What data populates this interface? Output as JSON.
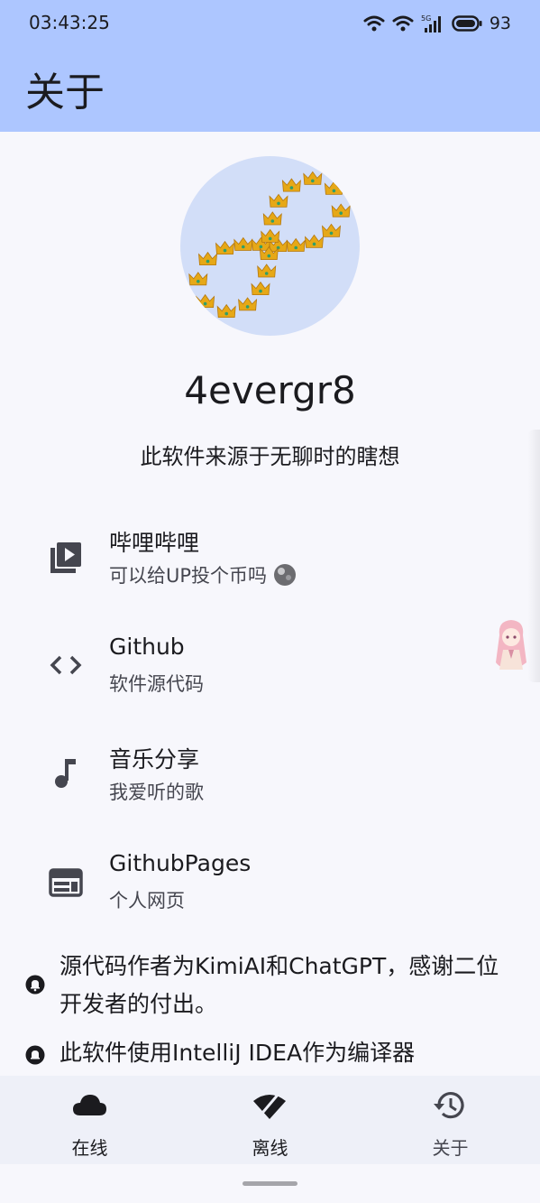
{
  "status_bar": {
    "time": "03:43:25",
    "battery": "93",
    "network": "5G"
  },
  "app_bar": {
    "title": "关于"
  },
  "profile": {
    "username": "4evergr8",
    "tagline": "此软件来源于无聊时的瞎想"
  },
  "links": [
    {
      "title": "哔哩哔哩",
      "subtitle": "可以给UP投个币吗",
      "icon": "video-library-icon"
    },
    {
      "title": "Github",
      "subtitle": "软件源代码",
      "icon": "code-icon"
    },
    {
      "title": "音乐分享",
      "subtitle": "我爱听的歌",
      "icon": "music-note-icon"
    },
    {
      "title": "GithubPages",
      "subtitle": "个人网页",
      "icon": "web-page-icon"
    }
  ],
  "notes": [
    {
      "text": "源代码作者为KimiAI和ChatGPT，感谢二位开发者的付出。"
    },
    {
      "text": "此软件使用IntelliJ IDEA作为编译器"
    }
  ],
  "bottom_nav": [
    {
      "label": "在线",
      "icon": "cloud-icon"
    },
    {
      "label": "离线",
      "icon": "wifi-off-icon"
    },
    {
      "label": "关于",
      "icon": "history-icon"
    }
  ],
  "colors": {
    "top_bar": "#adc6ff",
    "background": "#f7f7fc",
    "avatar_bg": "#d2def8",
    "crown": "#e6a817",
    "nav_bg": "#eef0f8"
  }
}
